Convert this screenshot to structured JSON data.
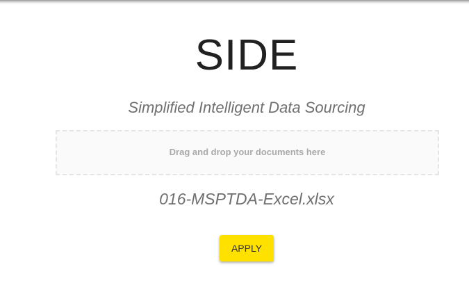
{
  "app": {
    "title": "SIDE",
    "subtitle": "Simplified Intelligent Data Sourcing"
  },
  "upload": {
    "dropzone_label": "Drag and drop your documents here",
    "selected_file": "016-MSPTDA-Excel.xlsx"
  },
  "actions": {
    "apply_label": "APPLY"
  },
  "colors": {
    "accent": "#ffe100",
    "title_text": "#212121",
    "muted_text": "#707070",
    "dropzone_border": "#e4e4e4"
  }
}
